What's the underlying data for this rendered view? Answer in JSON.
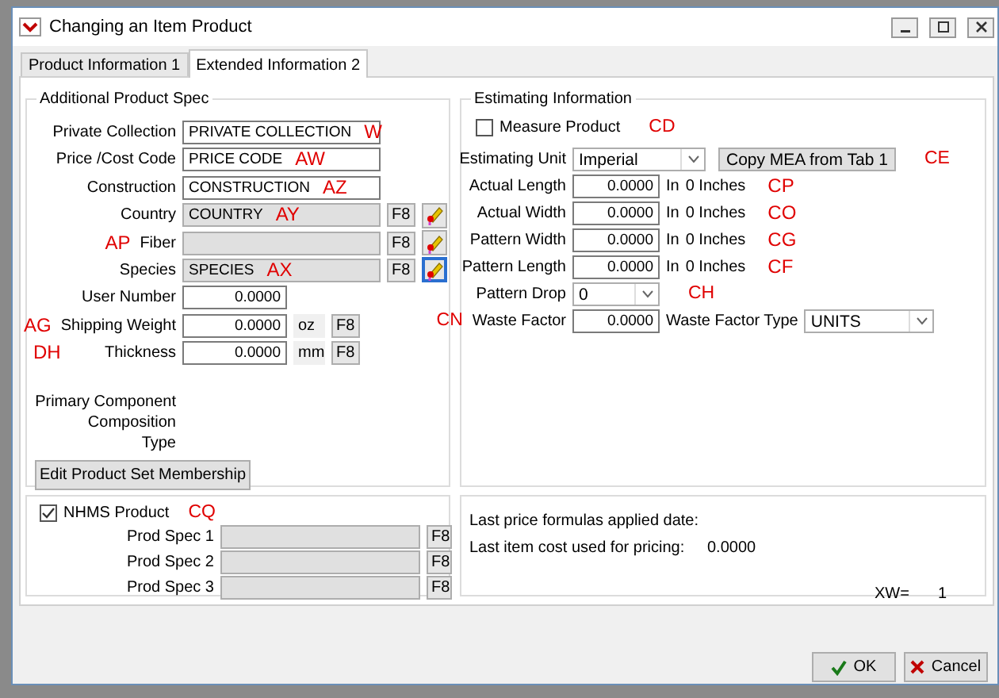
{
  "window": {
    "title": "Changing an Item Product"
  },
  "tabs": [
    {
      "label": "Product Information 1",
      "selected": false
    },
    {
      "label": "Extended Information 2",
      "selected": true
    }
  ],
  "product_spec": {
    "title": "Additional Product Spec",
    "rows": [
      {
        "kind": "text",
        "label": "Private Collection",
        "value": "PRIVATE COLLECTION",
        "tag": "W"
      },
      {
        "kind": "text",
        "label": "Price /Cost Code",
        "value": "PRICE CODE",
        "tag": "AW"
      },
      {
        "kind": "text",
        "label": "Construction",
        "value": "CONSTRUCTION",
        "tag": "AZ"
      },
      {
        "kind": "lookup",
        "label": "Country",
        "value": "COUNTRY",
        "tag": "AY",
        "key": "F8",
        "focused": false
      },
      {
        "kind": "lookup",
        "label": "Fiber",
        "side_tag": "AP",
        "key": "F8",
        "focused": false
      },
      {
        "kind": "lookup",
        "label": "Species",
        "value": "SPECIES",
        "tag": "AX",
        "key": "F8",
        "focused": true
      },
      {
        "kind": "number",
        "label": "User Number",
        "value": "0.0000"
      },
      {
        "kind": "number",
        "label": "Shipping Weight",
        "value": "0.0000",
        "unit": "oz",
        "key": "F8",
        "side_tag": "AG"
      },
      {
        "kind": "number",
        "label": "Thickness",
        "value": "0.0000",
        "unit": "mm",
        "key": "F8",
        "side_tag": "DH"
      }
    ],
    "notes": [
      "Primary Component",
      "Composition",
      "Type"
    ],
    "button": "Edit Product Set Membership"
  },
  "estimating": {
    "title": "Estimating Information",
    "measure": {
      "label": "Measure Product",
      "checked": false,
      "tag": "CD"
    },
    "unit": {
      "label": "Estimating Unit",
      "value": "Imperial",
      "button": "Copy MEA from Tab 1",
      "tag": "CE"
    },
    "rows": [
      {
        "kind": "measure",
        "label": "Actual Length",
        "value": "0.0000",
        "unit": "In",
        "reading": "0 Inches",
        "tag": "CP"
      },
      {
        "kind": "measure",
        "label": "Actual Width",
        "value": "0.0000",
        "unit": "In",
        "reading": "0 Inches",
        "tag": "CO"
      },
      {
        "kind": "measure",
        "label": "Pattern Width",
        "value": "0.0000",
        "unit": "In",
        "reading": "0 Inches",
        "tag": "CG"
      },
      {
        "kind": "measure",
        "label": "Pattern Length",
        "value": "0.0000",
        "unit": "In",
        "reading": "0 Inches",
        "tag": "CF"
      },
      {
        "kind": "select",
        "label": "Pattern Drop",
        "value": "0",
        "tag": "CH"
      },
      {
        "kind": "waste",
        "label": "Waste Factor",
        "value": "0.0000",
        "side_tag": "CN",
        "type_label": "Waste Factor Type",
        "type_value": "UNITS"
      }
    ]
  },
  "nhms": {
    "label": "NHMS Product",
    "checked": true,
    "tag": "CQ",
    "specs": [
      {
        "label": "Prod Spec 1",
        "key": "F8"
      },
      {
        "label": "Prod Spec 2",
        "key": "F8"
      },
      {
        "label": "Prod Spec 3",
        "key": "F8"
      }
    ]
  },
  "pricing": {
    "lines": [
      {
        "label": "Last price  formulas applied date:"
      },
      {
        "label": "Last item cost used for pricing:",
        "value": "0.0000"
      }
    ],
    "xw_label": "XW=",
    "xw_value": "1"
  },
  "buttons": [
    {
      "kind": "ok",
      "label": "OK"
    },
    {
      "kind": "cancel",
      "label": "Cancel"
    }
  ]
}
